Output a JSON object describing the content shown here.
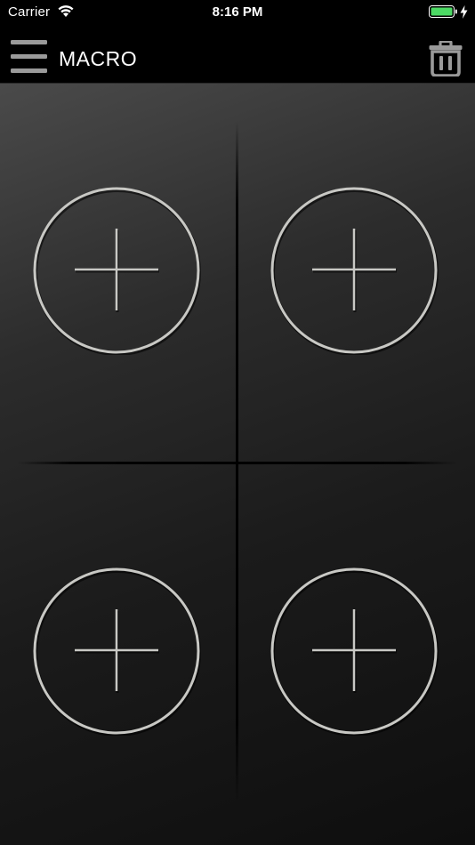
{
  "status_bar": {
    "carrier": "Carrier",
    "time": "8:16 PM",
    "battery_color": "#4cd964"
  },
  "nav_bar": {
    "title": "MACRO",
    "menu_icon": "hamburger-menu-icon",
    "trash_icon": "trash-icon"
  },
  "macro_slots": [
    {
      "slot": 1,
      "icon": "plus-circle-icon"
    },
    {
      "slot": 2,
      "icon": "plus-circle-icon"
    },
    {
      "slot": 3,
      "icon": "plus-circle-icon"
    },
    {
      "slot": 4,
      "icon": "plus-circle-icon"
    }
  ],
  "colors": {
    "accent": "#c8c8c4",
    "icon_gray": "#9a9a9a",
    "background": "#000000"
  }
}
